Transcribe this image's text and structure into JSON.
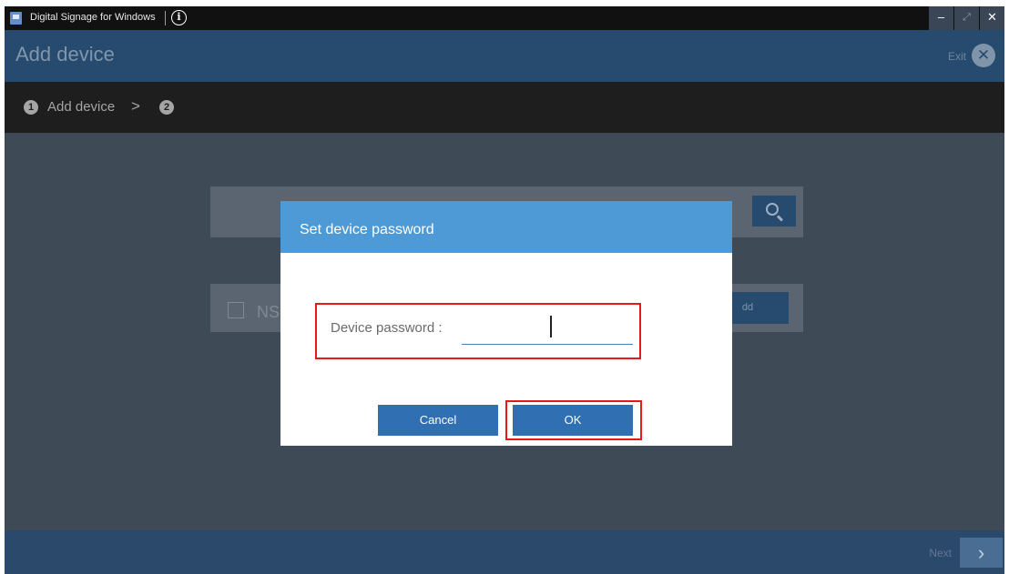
{
  "window": {
    "title": "Digital Signage for Windows",
    "info_glyph": "i",
    "minimize": "–",
    "restore": "⤢",
    "close": "✕"
  },
  "header": {
    "title": "Add device",
    "exit_label": "Exit",
    "exit_glyph": "✕"
  },
  "steps": [
    {
      "number": "1",
      "label": "Add device"
    },
    {
      "number": "2",
      "label": ""
    }
  ],
  "steps_separator": ">",
  "background": {
    "device_name": "NS(",
    "add_label": "dd"
  },
  "footer": {
    "next_label": "Next",
    "next_glyph": "›"
  },
  "dialog": {
    "title": "Set device password",
    "password_label": "Device password :",
    "password_value": "",
    "cancel_label": "Cancel",
    "ok_label": "OK"
  },
  "colors": {
    "header": "#264b6f",
    "dialog_header": "#4e9ad6",
    "button": "#2f6fb2",
    "highlight": "#e31a1a"
  },
  "icons": {
    "app": "digital-signage-app-icon",
    "info": "info-icon",
    "exit": "close-circle-icon",
    "search": "search-icon",
    "next": "chevron-right-icon"
  }
}
